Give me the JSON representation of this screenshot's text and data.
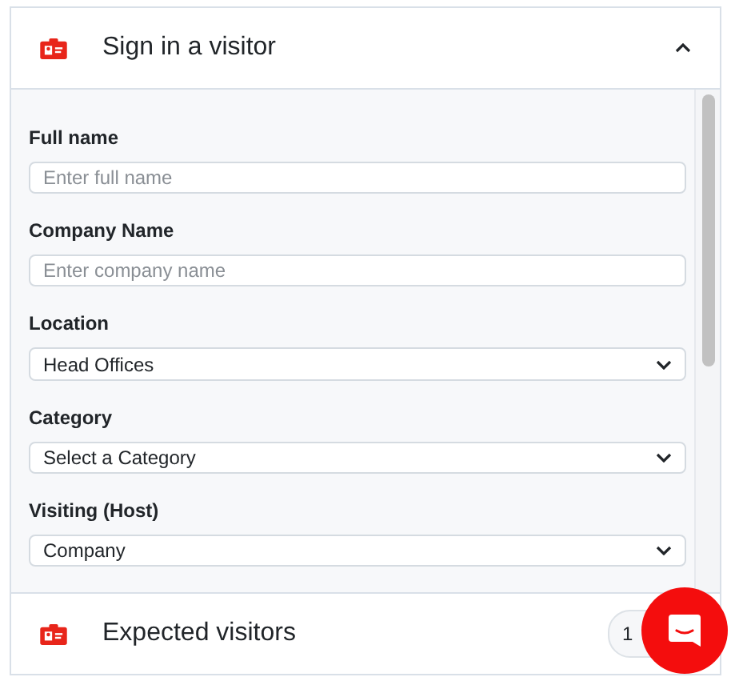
{
  "sections": [
    {
      "title": "Sign in a visitor",
      "expanded": true
    },
    {
      "title": "Expected visitors",
      "expanded": false,
      "count": "1"
    }
  ],
  "fields": [
    {
      "label": "Full name",
      "kind": "text",
      "placeholder": "Enter full name"
    },
    {
      "label": "Company Name",
      "kind": "text",
      "placeholder": "Enter company name"
    },
    {
      "label": "Location",
      "kind": "select",
      "value": "Head Offices"
    },
    {
      "label": "Category",
      "kind": "select",
      "value": "Select a Category"
    },
    {
      "label": "Visiting (Host)",
      "kind": "select",
      "value": "Company"
    }
  ]
}
